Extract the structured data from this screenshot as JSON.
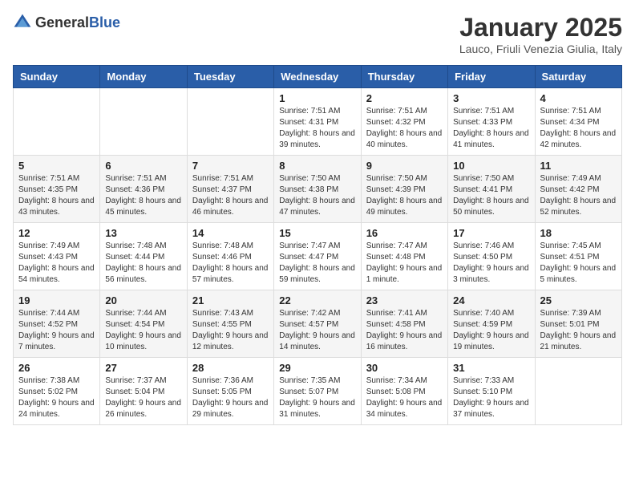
{
  "header": {
    "logo_general": "General",
    "logo_blue": "Blue",
    "title": "January 2025",
    "subtitle": "Lauco, Friuli Venezia Giulia, Italy"
  },
  "weekdays": [
    "Sunday",
    "Monday",
    "Tuesday",
    "Wednesday",
    "Thursday",
    "Friday",
    "Saturday"
  ],
  "weeks": [
    [
      {
        "day": "",
        "sunrise": "",
        "sunset": "",
        "daylight": ""
      },
      {
        "day": "",
        "sunrise": "",
        "sunset": "",
        "daylight": ""
      },
      {
        "day": "",
        "sunrise": "",
        "sunset": "",
        "daylight": ""
      },
      {
        "day": "1",
        "sunrise": "Sunrise: 7:51 AM",
        "sunset": "Sunset: 4:31 PM",
        "daylight": "Daylight: 8 hours and 39 minutes."
      },
      {
        "day": "2",
        "sunrise": "Sunrise: 7:51 AM",
        "sunset": "Sunset: 4:32 PM",
        "daylight": "Daylight: 8 hours and 40 minutes."
      },
      {
        "day": "3",
        "sunrise": "Sunrise: 7:51 AM",
        "sunset": "Sunset: 4:33 PM",
        "daylight": "Daylight: 8 hours and 41 minutes."
      },
      {
        "day": "4",
        "sunrise": "Sunrise: 7:51 AM",
        "sunset": "Sunset: 4:34 PM",
        "daylight": "Daylight: 8 hours and 42 minutes."
      }
    ],
    [
      {
        "day": "5",
        "sunrise": "Sunrise: 7:51 AM",
        "sunset": "Sunset: 4:35 PM",
        "daylight": "Daylight: 8 hours and 43 minutes."
      },
      {
        "day": "6",
        "sunrise": "Sunrise: 7:51 AM",
        "sunset": "Sunset: 4:36 PM",
        "daylight": "Daylight: 8 hours and 45 minutes."
      },
      {
        "day": "7",
        "sunrise": "Sunrise: 7:51 AM",
        "sunset": "Sunset: 4:37 PM",
        "daylight": "Daylight: 8 hours and 46 minutes."
      },
      {
        "day": "8",
        "sunrise": "Sunrise: 7:50 AM",
        "sunset": "Sunset: 4:38 PM",
        "daylight": "Daylight: 8 hours and 47 minutes."
      },
      {
        "day": "9",
        "sunrise": "Sunrise: 7:50 AM",
        "sunset": "Sunset: 4:39 PM",
        "daylight": "Daylight: 8 hours and 49 minutes."
      },
      {
        "day": "10",
        "sunrise": "Sunrise: 7:50 AM",
        "sunset": "Sunset: 4:41 PM",
        "daylight": "Daylight: 8 hours and 50 minutes."
      },
      {
        "day": "11",
        "sunrise": "Sunrise: 7:49 AM",
        "sunset": "Sunset: 4:42 PM",
        "daylight": "Daylight: 8 hours and 52 minutes."
      }
    ],
    [
      {
        "day": "12",
        "sunrise": "Sunrise: 7:49 AM",
        "sunset": "Sunset: 4:43 PM",
        "daylight": "Daylight: 8 hours and 54 minutes."
      },
      {
        "day": "13",
        "sunrise": "Sunrise: 7:48 AM",
        "sunset": "Sunset: 4:44 PM",
        "daylight": "Daylight: 8 hours and 56 minutes."
      },
      {
        "day": "14",
        "sunrise": "Sunrise: 7:48 AM",
        "sunset": "Sunset: 4:46 PM",
        "daylight": "Daylight: 8 hours and 57 minutes."
      },
      {
        "day": "15",
        "sunrise": "Sunrise: 7:47 AM",
        "sunset": "Sunset: 4:47 PM",
        "daylight": "Daylight: 8 hours and 59 minutes."
      },
      {
        "day": "16",
        "sunrise": "Sunrise: 7:47 AM",
        "sunset": "Sunset: 4:48 PM",
        "daylight": "Daylight: 9 hours and 1 minute."
      },
      {
        "day": "17",
        "sunrise": "Sunrise: 7:46 AM",
        "sunset": "Sunset: 4:50 PM",
        "daylight": "Daylight: 9 hours and 3 minutes."
      },
      {
        "day": "18",
        "sunrise": "Sunrise: 7:45 AM",
        "sunset": "Sunset: 4:51 PM",
        "daylight": "Daylight: 9 hours and 5 minutes."
      }
    ],
    [
      {
        "day": "19",
        "sunrise": "Sunrise: 7:44 AM",
        "sunset": "Sunset: 4:52 PM",
        "daylight": "Daylight: 9 hours and 7 minutes."
      },
      {
        "day": "20",
        "sunrise": "Sunrise: 7:44 AM",
        "sunset": "Sunset: 4:54 PM",
        "daylight": "Daylight: 9 hours and 10 minutes."
      },
      {
        "day": "21",
        "sunrise": "Sunrise: 7:43 AM",
        "sunset": "Sunset: 4:55 PM",
        "daylight": "Daylight: 9 hours and 12 minutes."
      },
      {
        "day": "22",
        "sunrise": "Sunrise: 7:42 AM",
        "sunset": "Sunset: 4:57 PM",
        "daylight": "Daylight: 9 hours and 14 minutes."
      },
      {
        "day": "23",
        "sunrise": "Sunrise: 7:41 AM",
        "sunset": "Sunset: 4:58 PM",
        "daylight": "Daylight: 9 hours and 16 minutes."
      },
      {
        "day": "24",
        "sunrise": "Sunrise: 7:40 AM",
        "sunset": "Sunset: 4:59 PM",
        "daylight": "Daylight: 9 hours and 19 minutes."
      },
      {
        "day": "25",
        "sunrise": "Sunrise: 7:39 AM",
        "sunset": "Sunset: 5:01 PM",
        "daylight": "Daylight: 9 hours and 21 minutes."
      }
    ],
    [
      {
        "day": "26",
        "sunrise": "Sunrise: 7:38 AM",
        "sunset": "Sunset: 5:02 PM",
        "daylight": "Daylight: 9 hours and 24 minutes."
      },
      {
        "day": "27",
        "sunrise": "Sunrise: 7:37 AM",
        "sunset": "Sunset: 5:04 PM",
        "daylight": "Daylight: 9 hours and 26 minutes."
      },
      {
        "day": "28",
        "sunrise": "Sunrise: 7:36 AM",
        "sunset": "Sunset: 5:05 PM",
        "daylight": "Daylight: 9 hours and 29 minutes."
      },
      {
        "day": "29",
        "sunrise": "Sunrise: 7:35 AM",
        "sunset": "Sunset: 5:07 PM",
        "daylight": "Daylight: 9 hours and 31 minutes."
      },
      {
        "day": "30",
        "sunrise": "Sunrise: 7:34 AM",
        "sunset": "Sunset: 5:08 PM",
        "daylight": "Daylight: 9 hours and 34 minutes."
      },
      {
        "day": "31",
        "sunrise": "Sunrise: 7:33 AM",
        "sunset": "Sunset: 5:10 PM",
        "daylight": "Daylight: 9 hours and 37 minutes."
      },
      {
        "day": "",
        "sunrise": "",
        "sunset": "",
        "daylight": ""
      }
    ]
  ]
}
